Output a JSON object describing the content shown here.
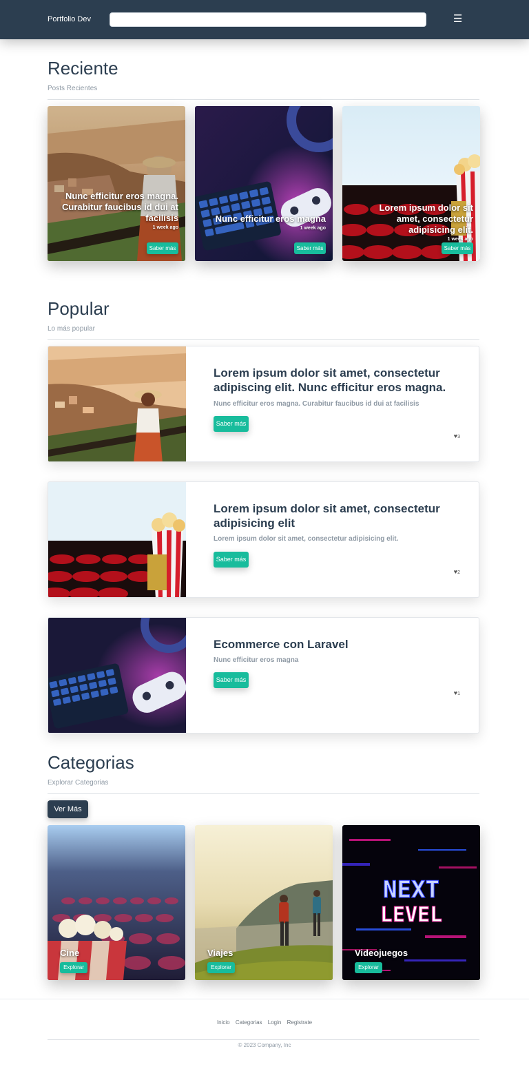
{
  "navbar": {
    "brand": "Portfolio Dev",
    "search_value": "",
    "menu_icon": "☰"
  },
  "recent": {
    "title": "Reciente",
    "subtitle": "Posts Recientes",
    "cards": [
      {
        "title": "Nunc efficitur eros magna. Curabitur faucibus id dui at facilisis",
        "time": "1 week ago",
        "button": "Saber más",
        "image": "coastal-town-photo"
      },
      {
        "title": "Nunc efficitur eros magna",
        "time": "1 week ago",
        "button": "Saber más",
        "image": "keyboard-controller-photo"
      },
      {
        "title": "Lorem ipsum dolor sit amet, consectetur adipisicing elit.",
        "time": "1 week ago",
        "button": "Saber más",
        "image": "cinema-popcorn-photo"
      }
    ]
  },
  "popular": {
    "title": "Popular",
    "subtitle": "Lo más popular",
    "posts": [
      {
        "title": "Lorem ipsum dolor sit amet, consectetur adipiscing elit. Nunc efficitur eros magna.",
        "desc": "Nunc efficitur eros magna. Curabitur faucibus id dui at facilisis",
        "button": "Saber más",
        "likes": "3",
        "image": "coastal-town-photo"
      },
      {
        "title": "Lorem ipsum dolor sit amet, consectetur adipisicing elit",
        "desc": "Lorem ipsum dolor sit amet, consectetur adipisicing elit.",
        "button": "Saber más",
        "likes": "2",
        "image": "cinema-popcorn-photo"
      },
      {
        "title": "Ecommerce con Laravel",
        "desc": "Nunc efficitur eros magna",
        "button": "Saber más",
        "likes": "1",
        "image": "keyboard-controller-photo"
      }
    ]
  },
  "categories": {
    "title": "Categorias",
    "subtitle": "Explorar Categorias",
    "more_button": "Ver Más",
    "items": [
      {
        "name": "Cine",
        "button": "Explorar",
        "image": "cinema-seats-photo"
      },
      {
        "name": "Viajes",
        "button": "Explorar",
        "image": "hikers-cliff-photo"
      },
      {
        "name": "Videojuegos",
        "button": "Explorar",
        "image": "next-level-glitch-photo"
      }
    ]
  },
  "footer": {
    "links": [
      "Inicio",
      "Categorias",
      "Login",
      "Registrate"
    ],
    "copyright": "© 2023 Company, Inc"
  },
  "colors": {
    "navbar": "#2c3e50",
    "accent": "#18bc9c",
    "text_muted": "#8f9aa5"
  }
}
